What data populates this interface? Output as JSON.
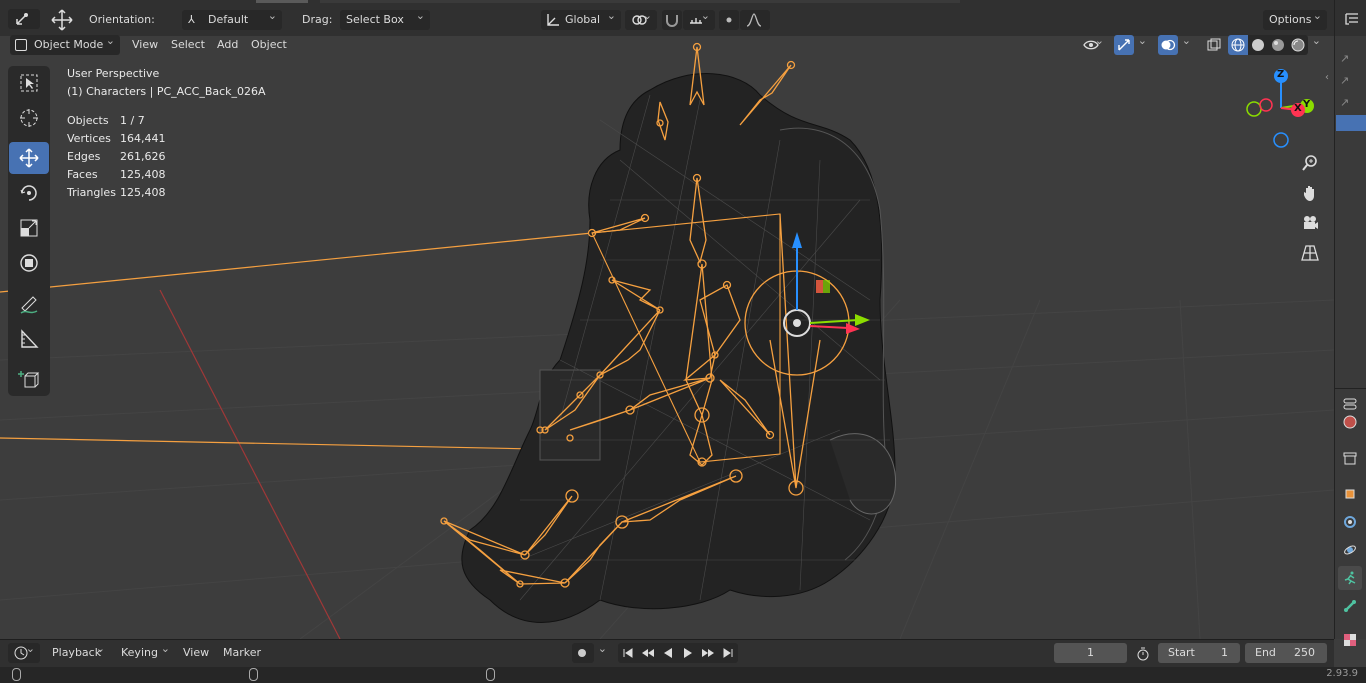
{
  "header": {
    "orientation_label": "Orientation:",
    "orientation_value": "Default",
    "drag_label": "Drag:",
    "drag_value": "Select Box",
    "transform_space": "Global",
    "options_label": "Options"
  },
  "viewport_header": {
    "mode": "Object Mode",
    "menus": [
      "View",
      "Select",
      "Add",
      "Object"
    ]
  },
  "overlay": {
    "view_name": "User Perspective",
    "collection_object": "(1) Characters | PC_ACC_Back_026A",
    "stats": [
      {
        "label": "Objects",
        "value": "1 / 7"
      },
      {
        "label": "Vertices",
        "value": "164,441"
      },
      {
        "label": "Edges",
        "value": "261,626"
      },
      {
        "label": "Faces",
        "value": "125,408"
      },
      {
        "label": "Triangles",
        "value": "125,408"
      }
    ]
  },
  "gizmo_axes": {
    "x": "X",
    "y": "Y",
    "z": "Z"
  },
  "timeline": {
    "menus": [
      "Playback",
      "Keying",
      "View",
      "Marker"
    ],
    "current_frame": "1",
    "start_label": "Start",
    "start_value": "1",
    "end_label": "End",
    "end_value": "250"
  },
  "status_bar": {
    "version": "2.93.9"
  },
  "colors": {
    "accent": "#4772b3",
    "selection_orange": "#f5a040",
    "axis_x": "#ff3352",
    "axis_y": "#8bdc00",
    "axis_z": "#2890ff"
  }
}
